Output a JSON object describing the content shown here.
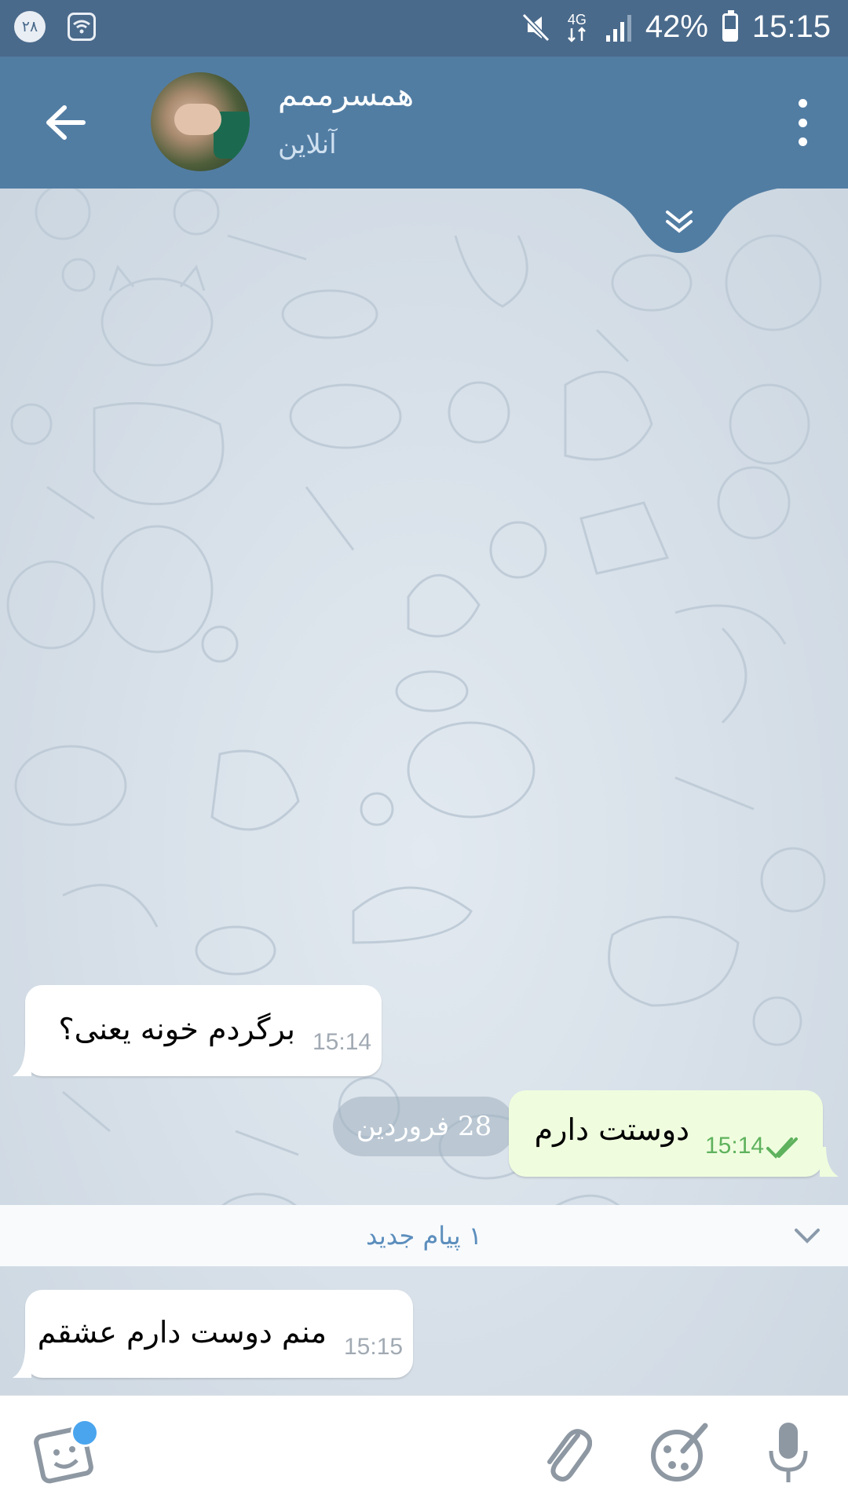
{
  "status_bar": {
    "notification_count": "۲۸",
    "network_type": "4G",
    "battery": "42%",
    "battery_level": 0.42,
    "time": "15:15",
    "icons": [
      "wifi-icon",
      "mute-icon",
      "signal-icon",
      "battery-icon"
    ]
  },
  "header": {
    "contact_name": "همسرممم",
    "contact_status": "آنلاین",
    "icons": [
      "back-arrow-icon",
      "more-vertical-icon"
    ]
  },
  "chat": {
    "date_label": "28 فروردین",
    "messages": [
      {
        "direction": "in",
        "text": "برگردم خونه یعنی؟",
        "time": "15:14"
      },
      {
        "direction": "out",
        "text": "دوستت دارم",
        "time": "15:14",
        "status": "read"
      },
      {
        "direction": "in",
        "text": "منم دوست دارم عشقم",
        "time": "15:15"
      }
    ],
    "new_messages_label": "۱ پیام جدید"
  },
  "input_bar": {
    "icons": [
      "sticker-icon",
      "attach-icon",
      "paint-icon",
      "microphone-icon"
    ],
    "accent_color": "#4aa5ee"
  },
  "colors": {
    "status_bar": "#4a6a8b",
    "header": "#527da3",
    "outgoing_bubble": "#effdde",
    "read_check": "#5fb25d"
  }
}
